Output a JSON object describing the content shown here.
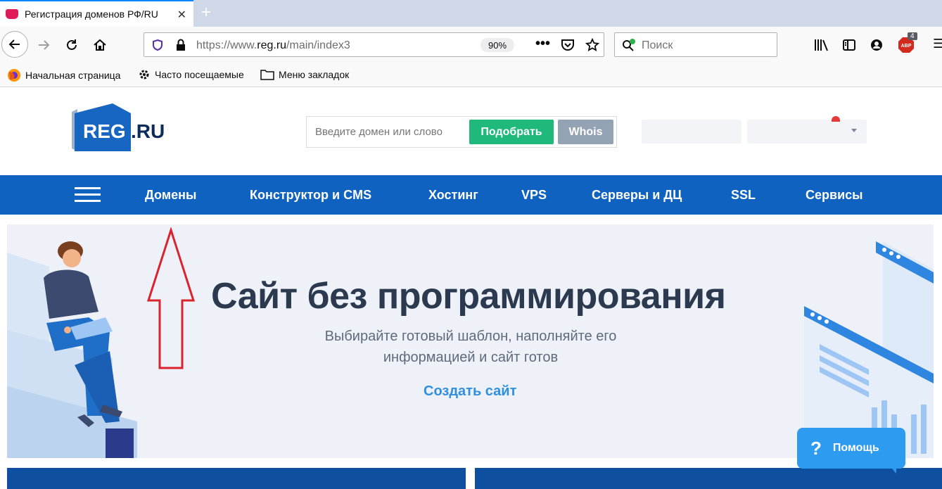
{
  "browser": {
    "tab_title": "Регистрация доменов РФ/RU",
    "url_prefix": "https://www.",
    "url_host": "reg.ru",
    "url_path": "/main/index3",
    "zoom": "90%",
    "search_placeholder": "Поиск",
    "adblock_badge": "4",
    "bookmarks": [
      {
        "label": "Начальная страница",
        "icon": "firefox-icon"
      },
      {
        "label": "Часто посещаемые",
        "icon": "gear-icon"
      },
      {
        "label": "Меню закладок",
        "icon": "folder-icon"
      }
    ]
  },
  "site": {
    "logo_main": "REG",
    "logo_suffix": ".RU",
    "domain_placeholder": "Введите домен или слово",
    "pick_button": "Подобрать",
    "whois_button": "Whois",
    "menu": [
      "Домены",
      "Конструктор и CMS",
      "Хостинг",
      "VPS",
      "Серверы и ДЦ",
      "SSL",
      "Сервисы"
    ],
    "hero": {
      "title": "Сайт без программирования",
      "subtitle": "Выбирайте готовый шаблон, наполняйте его информацией и сайт готов",
      "link": "Создать сайт"
    },
    "help_icon": "?",
    "help_label": "Помощь"
  },
  "colors": {
    "brand_blue": "#0f62c0",
    "pick_green": "#1fb97b",
    "whois_gray": "#94a3b4",
    "annotation_red": "#d9232d",
    "help_blue": "#2d9bf0"
  }
}
